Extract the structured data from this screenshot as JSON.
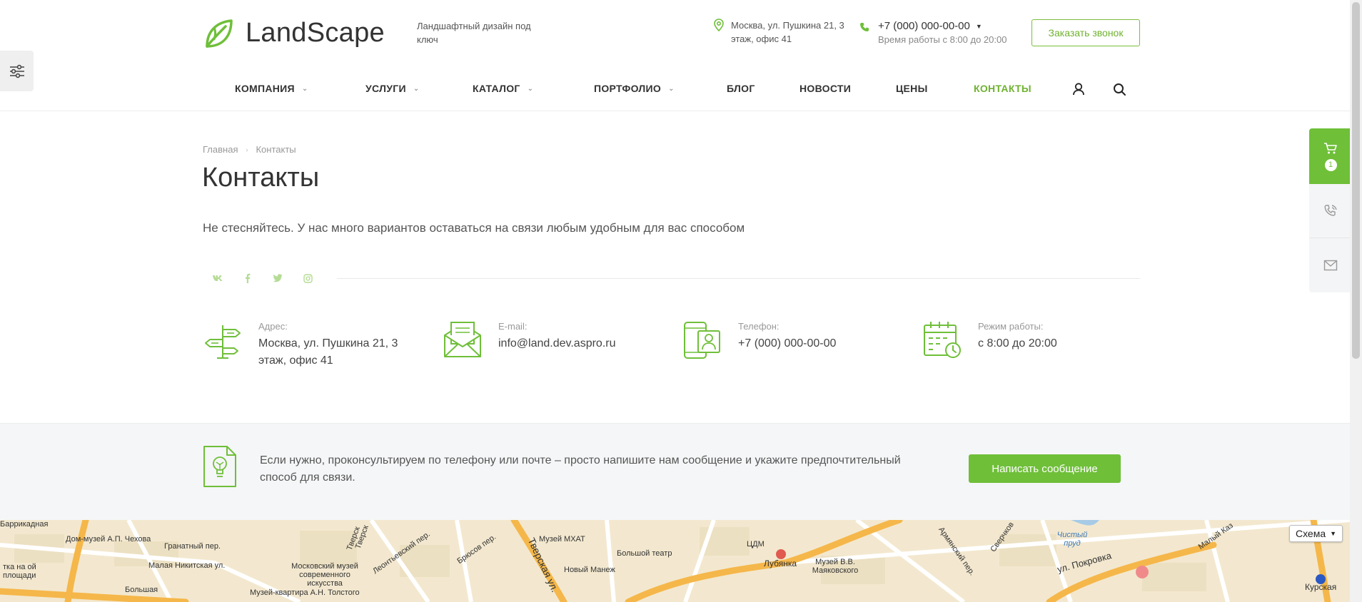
{
  "header": {
    "logo_text": "LandScape",
    "tagline": "Ландшафтный дизайн под ключ",
    "address": "Москва, ул. Пушкина 21, 3 этаж, офис 41",
    "phone": "+7 (000) 000-00-00",
    "hours": "Время работы с 8:00 до 20:00",
    "callback_label": "Заказать звонок"
  },
  "nav": {
    "items": [
      {
        "label": "КОМПАНИЯ",
        "dropdown": true
      },
      {
        "label": "УСЛУГИ",
        "dropdown": true
      },
      {
        "label": "КАТАЛОГ",
        "dropdown": true
      },
      {
        "label": "ПОРТФОЛИО",
        "dropdown": true
      },
      {
        "label": "БЛОГ",
        "dropdown": false
      },
      {
        "label": "НОВОСТИ",
        "dropdown": false
      },
      {
        "label": "ЦЕНЫ",
        "dropdown": false
      },
      {
        "label": "КОНТАКТЫ",
        "dropdown": false,
        "active": true
      }
    ],
    "icons": [
      "user-icon",
      "search-icon"
    ]
  },
  "breadcrumb": {
    "home": "Главная",
    "current": "Контакты"
  },
  "page": {
    "title": "Контакты",
    "lead": "Не стесняйтесь. У нас много вариантов оставаться на связи любым удобным для вас способом"
  },
  "social": [
    "vk-icon",
    "facebook-icon",
    "twitter-icon",
    "instagram-icon"
  ],
  "contacts": [
    {
      "label": "Адрес:",
      "value": "Москва, ул. Пушкина 21, 3 этаж, офис 41",
      "icon": "signpost-icon"
    },
    {
      "label": "E-mail:",
      "value": "info@land.dev.aspro.ru",
      "icon": "envelope-icon"
    },
    {
      "label": "Телефон:",
      "value": "+7 (000) 000-00-00",
      "icon": "phone-contact-icon"
    },
    {
      "label": "Режим работы:",
      "value": "с 8:00 до 20:00",
      "icon": "calendar-clock-icon"
    }
  ],
  "consult": {
    "message": "Если нужно, проконсультируем по телефону или почте – просто напишите нам сообщение и укажите предпочтительный способ для связи.",
    "button": "Написать сообщение"
  },
  "side_panel": {
    "cart_count": "1"
  },
  "map": {
    "scheme_label": "Схема",
    "labels": [
      "Баррикадная",
      "Дом-музей А.П. Чехова",
      "Гранатный пер.",
      "Малая Никитская ул.",
      "Московский музей современного искусства",
      "Музей-квартира А.Н. Толстого",
      "Леонтьевский пер.",
      "Брюсов пер.",
      "Тверская ул.",
      "Музей МХАТ",
      "Новый Манеж",
      "Большой театр",
      "ЦДМ",
      "Лубянка",
      "Музей В.В. Маяковского",
      "Армянский пер.",
      "Сверчков",
      "Чистый пруд",
      "ул. Покровка",
      "Малый Каз",
      "Курская",
      "Тверск",
      "Тверск",
      "Большая",
      "тка на ой площади"
    ]
  },
  "colors": {
    "accent": "#6fbf39",
    "accent_text": "#6fb230",
    "text": "#333333",
    "muted": "#999999",
    "band_bg": "#f5f6f7",
    "map_bg": "#f3e8cf"
  }
}
